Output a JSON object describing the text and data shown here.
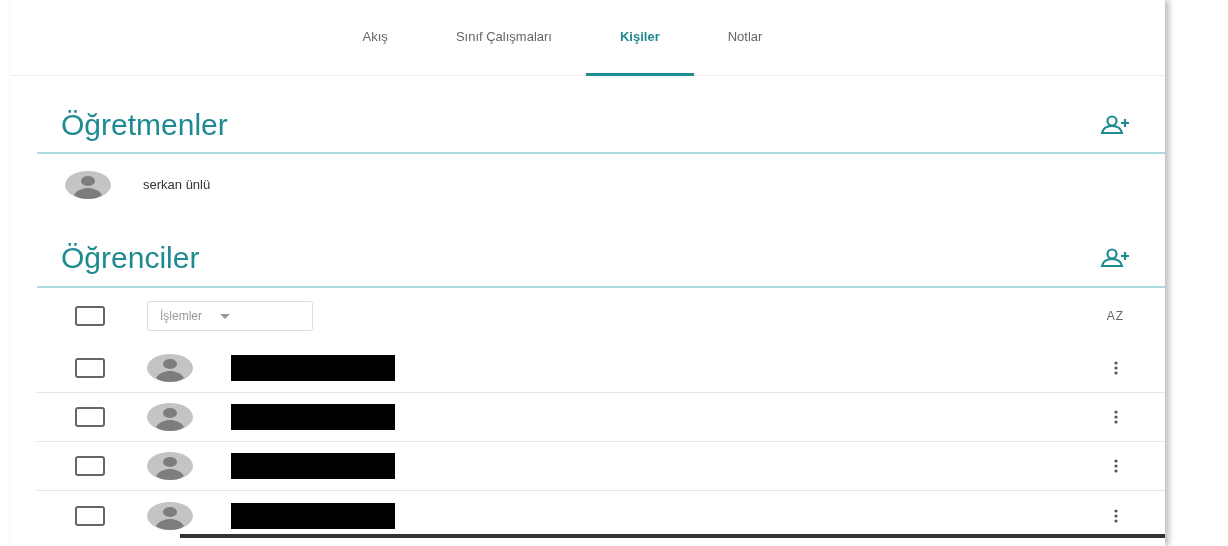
{
  "tabs": [
    {
      "label": "Akış",
      "selected": false
    },
    {
      "label": "Sınıf Çalışmaları",
      "selected": false
    },
    {
      "label": "Kişiler",
      "selected": true
    },
    {
      "label": "Notlar",
      "selected": false
    }
  ],
  "teachers": {
    "title": "Öğretmenler",
    "people": [
      {
        "name": "serkan ünlü"
      }
    ]
  },
  "students": {
    "title": "Öğrenciler",
    "select_all": {
      "checked": false
    },
    "actions_menu": {
      "label": "İşlemler",
      "disabled": true
    },
    "sort_button": {
      "label": "AZ"
    },
    "people": [
      {
        "checked": false,
        "name_redacted": true
      },
      {
        "checked": false,
        "name_redacted": true
      },
      {
        "checked": false,
        "name_redacted": true
      },
      {
        "checked": false,
        "name_redacted": true
      }
    ]
  }
}
